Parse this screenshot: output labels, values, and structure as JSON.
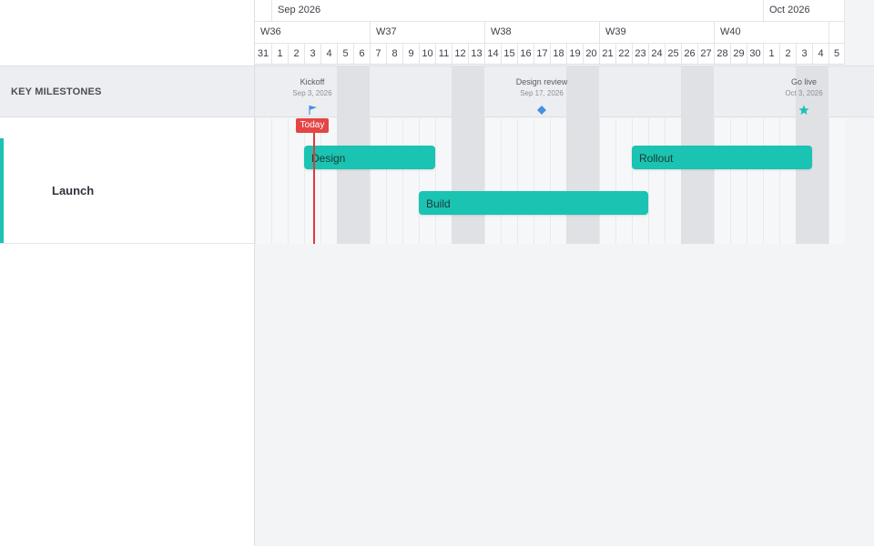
{
  "sidebar": {
    "milestones_label": "KEY MILESTONES",
    "group_name": "Launch"
  },
  "header": {
    "months": [
      "Sep 2026",
      "Oct 2026"
    ],
    "weeks": [
      "W36",
      "W37",
      "W38",
      "W39",
      "W40"
    ],
    "days": [
      "31",
      "1",
      "2",
      "3",
      "4",
      "5",
      "6",
      "7",
      "8",
      "9",
      "10",
      "11",
      "12",
      "13",
      "14",
      "15",
      "16",
      "17",
      "18",
      "19",
      "20",
      "21",
      "22",
      "23",
      "24",
      "25",
      "26",
      "27",
      "28",
      "29",
      "30",
      "1",
      "2",
      "3",
      "4",
      "5"
    ]
  },
  "milestones": [
    {
      "label": "Kickoff",
      "date": "Sep 3, 2026",
      "icon": "flag-icon"
    },
    {
      "label": "Design review",
      "date": "Sep 17, 2026",
      "icon": "diamond-icon"
    },
    {
      "label": "Go live",
      "date": "Oct 3, 2026",
      "icon": "star-icon"
    }
  ],
  "bars": [
    {
      "label": "Design",
      "start": "Sep 3, 2026",
      "end": "Sep 10, 2026"
    },
    {
      "label": "Build",
      "start": "Sep 10, 2026",
      "end": "Sep 23, 2026"
    },
    {
      "label": "Rollout",
      "start": "Sep 23, 2026",
      "end": "Oct 3, 2026"
    }
  ],
  "today_label": "Today",
  "colors": {
    "accent": "#1ac3b2",
    "today": "#e44545",
    "flag": "#4a90e2",
    "diamond": "#4a90e2",
    "star": "#1ac3b2"
  }
}
